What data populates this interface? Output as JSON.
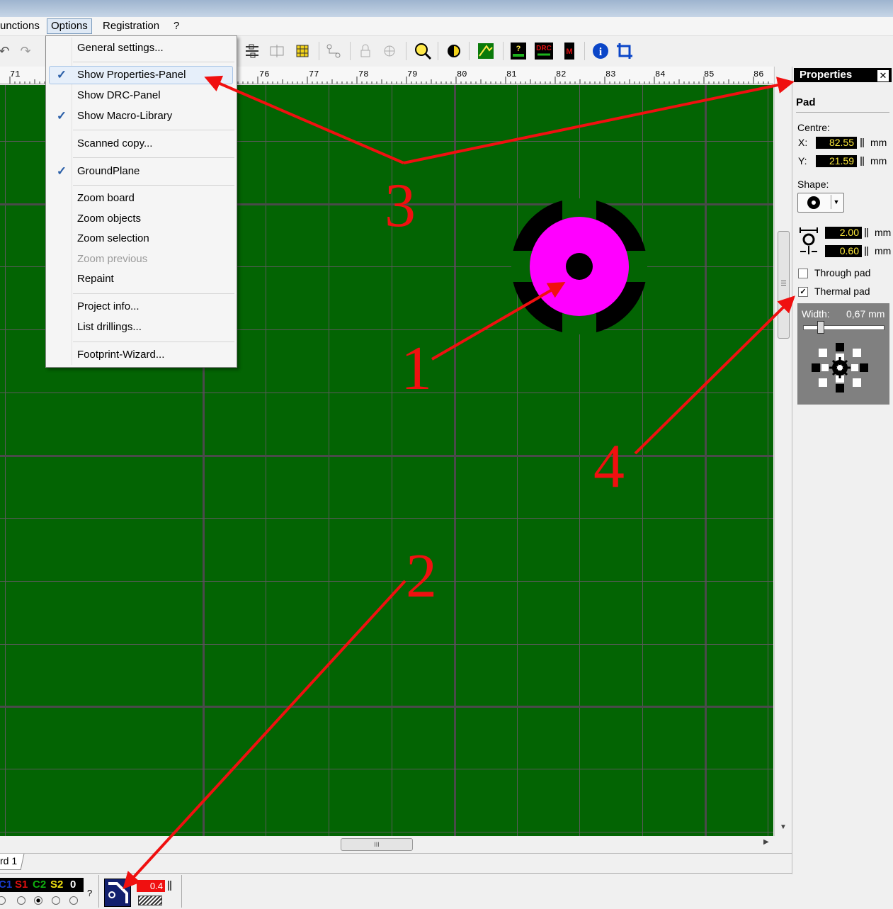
{
  "menubar": {
    "items": [
      "unctions",
      "Options",
      "Registration",
      "?"
    ]
  },
  "options_menu": {
    "items": [
      {
        "label": "General settings...",
        "checked": false,
        "disabled": false
      },
      {
        "label": "Show Properties-Panel",
        "checked": true,
        "disabled": false
      },
      {
        "label": "Show DRC-Panel",
        "checked": false,
        "disabled": false
      },
      {
        "label": "Show Macro-Library",
        "checked": true,
        "disabled": false
      },
      {
        "label": "Scanned copy...",
        "checked": false,
        "disabled": false
      },
      {
        "label": "GroundPlane",
        "checked": true,
        "disabled": false
      },
      {
        "label": "Zoom board",
        "checked": false,
        "disabled": false
      },
      {
        "label": "Zoom objects",
        "checked": false,
        "disabled": false
      },
      {
        "label": "Zoom selection",
        "checked": false,
        "disabled": false
      },
      {
        "label": "Zoom previous",
        "checked": false,
        "disabled": true
      },
      {
        "label": "Repaint",
        "checked": false,
        "disabled": false
      },
      {
        "label": "Project info...",
        "checked": false,
        "disabled": false
      },
      {
        "label": "List drillings...",
        "checked": false,
        "disabled": false
      },
      {
        "label": "Footprint-Wizard...",
        "checked": false,
        "disabled": false
      }
    ],
    "check_mark": "✓"
  },
  "toolbar": {
    "icons": [
      "undo-icon",
      "redo-icon",
      "align-icon",
      "mirror-icon",
      "component-icon",
      "route-icon",
      "lock-icon",
      "unlock-icon",
      "zoom-icon",
      "contrast-icon",
      "photo-view-icon",
      "test-icon",
      "drc-icon",
      "macro-icon",
      "info-icon",
      "crop-icon"
    ],
    "drc_label": "DRC"
  },
  "ruler": {
    "labels": [
      "71",
      "76",
      "77",
      "78",
      "79",
      "80",
      "81",
      "82",
      "83",
      "84",
      "85",
      "86"
    ]
  },
  "properties_panel": {
    "title": "Properties",
    "close": "✕",
    "section": "Pad",
    "centre_label": "Centre:",
    "x_label": "X:",
    "x_value": "82.55",
    "y_label": "Y:",
    "y_value": "21.59",
    "unit": "mm",
    "shape_label": "Shape:",
    "outer_diameter": "2.00",
    "drill_diameter": "0.60",
    "through_pad_label": "Through pad",
    "through_pad_checked": false,
    "thermal_pad_label": "Thermal pad",
    "thermal_pad_checked": true,
    "width_label": "Width:",
    "width_value": "0,67 mm",
    "width_slider": 0.18
  },
  "hscroll": {
    "grip": "III"
  },
  "tabs": {
    "label": "rd 1"
  },
  "statusbar": {
    "layers": [
      {
        "label": "C1",
        "color": "#1a3ccf"
      },
      {
        "label": "S1",
        "color": "#e01010"
      },
      {
        "label": "C2",
        "color": "#10b010"
      },
      {
        "label": "S2",
        "color": "#f0e010"
      },
      {
        "label": "0",
        "color": "#ffffff"
      }
    ],
    "question": "?",
    "track_width": "0.4"
  },
  "annotations": {
    "numbers": [
      "1",
      "2",
      "3",
      "4"
    ]
  },
  "colors": {
    "board": "#036403",
    "pad": "#ff00ff",
    "annotation": "#f01010"
  }
}
